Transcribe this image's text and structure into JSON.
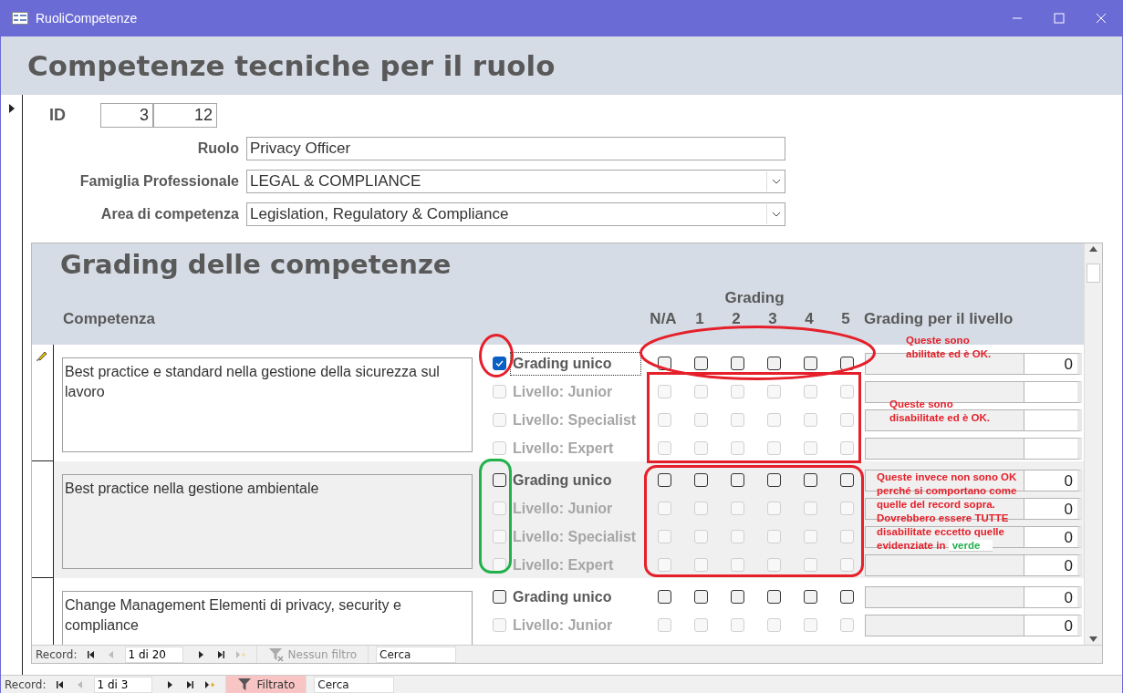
{
  "window": {
    "title": "RuoliCompetenze"
  },
  "form": {
    "title": "Competenze tecniche per il ruolo",
    "id_label": "ID",
    "id_values": [
      "3",
      "12"
    ],
    "fields": [
      {
        "label": "Ruolo",
        "value": "Privacy Officer",
        "kind": "text"
      },
      {
        "label": "Famiglia Professionale",
        "value": "LEGAL & COMPLIANCE",
        "kind": "combo"
      },
      {
        "label": "Area di competenza",
        "value": "Legislation, Regulatory & Compliance",
        "kind": "combo"
      }
    ]
  },
  "subform": {
    "title": "Grading delle competenze",
    "competenza_heading": "Competenza",
    "grading_heading": "Grading",
    "grades": [
      "N/A",
      "1",
      "2",
      "3",
      "4",
      "5"
    ],
    "level_heading": "Grading per il livello",
    "records": [
      {
        "competenza": "Best practice e standard nella gestione della sicurezza sul lavoro",
        "editing": true,
        "levels": [
          {
            "label": "Grading unico",
            "checked": true,
            "disabled": false,
            "focused": true,
            "grades_disabled": false,
            "value": "0"
          },
          {
            "label": "Livello: Junior",
            "checked": false,
            "disabled": true,
            "focused": false,
            "grades_disabled": true
          },
          {
            "label": "Livello: Specialist",
            "checked": false,
            "disabled": true,
            "focused": false,
            "grades_disabled": true
          },
          {
            "label": "Livello: Expert",
            "checked": false,
            "disabled": true,
            "focused": false,
            "grades_disabled": true
          }
        ]
      },
      {
        "competenza": "Best practice nella gestione ambientale",
        "editing": false,
        "levels": [
          {
            "label": "Grading unico",
            "checked": false,
            "disabled": false,
            "focused": false,
            "grades_disabled": false,
            "value": "0"
          },
          {
            "label": "Livello: Junior",
            "checked": false,
            "disabled": true,
            "focused": false,
            "grades_disabled": true,
            "value": "0"
          },
          {
            "label": "Livello: Specialist",
            "checked": false,
            "disabled": true,
            "focused": false,
            "grades_disabled": true,
            "value": "0"
          },
          {
            "label": "Livello: Expert",
            "checked": false,
            "disabled": true,
            "focused": false,
            "grades_disabled": true,
            "value": "0"
          }
        ]
      },
      {
        "competenza": "Change Management Elementi di privacy, security e compliance",
        "editing": false,
        "levels": [
          {
            "label": "Grading unico",
            "checked": false,
            "disabled": false,
            "focused": false,
            "grades_disabled": false,
            "value": "0"
          },
          {
            "label": "Livello: Junior",
            "checked": false,
            "disabled": true,
            "focused": false,
            "grades_disabled": true,
            "value": "0"
          }
        ]
      }
    ],
    "nav": {
      "label": "Record:",
      "position": "1 di 20",
      "filter": "Nessun filtro",
      "filter_active": false,
      "new_enabled": false,
      "search_placeholder": "Cerca"
    }
  },
  "nav": {
    "label": "Record:",
    "position": "1 di 3",
    "filter": "Filtrato",
    "filter_active": true,
    "new_enabled": true,
    "search_placeholder": "Cerca"
  },
  "annotations": [
    {
      "kind": "ellipse",
      "color": "#e5202a"
    },
    {
      "kind": "ellipse",
      "color": "#e5202a"
    },
    {
      "kind": "rect",
      "color": "#e5202a"
    },
    {
      "kind": "rounded",
      "color": "#e5202a"
    },
    {
      "kind": "rounded",
      "color": "#22b14c"
    }
  ],
  "notes": [
    {
      "lines": [
        "Queste sono",
        "abilitate ed è OK."
      ]
    },
    {
      "lines": [
        "Queste sono",
        "disabilitate ed è OK."
      ]
    },
    {
      "lines": [
        "Queste invece non sono OK",
        "perché si comportano come",
        "quelle del record sopra.",
        "Dovrebbero essere TUTTE",
        "disabilitate eccetto quelle",
        "evidenziate in"
      ],
      "highlight": "verde"
    }
  ]
}
